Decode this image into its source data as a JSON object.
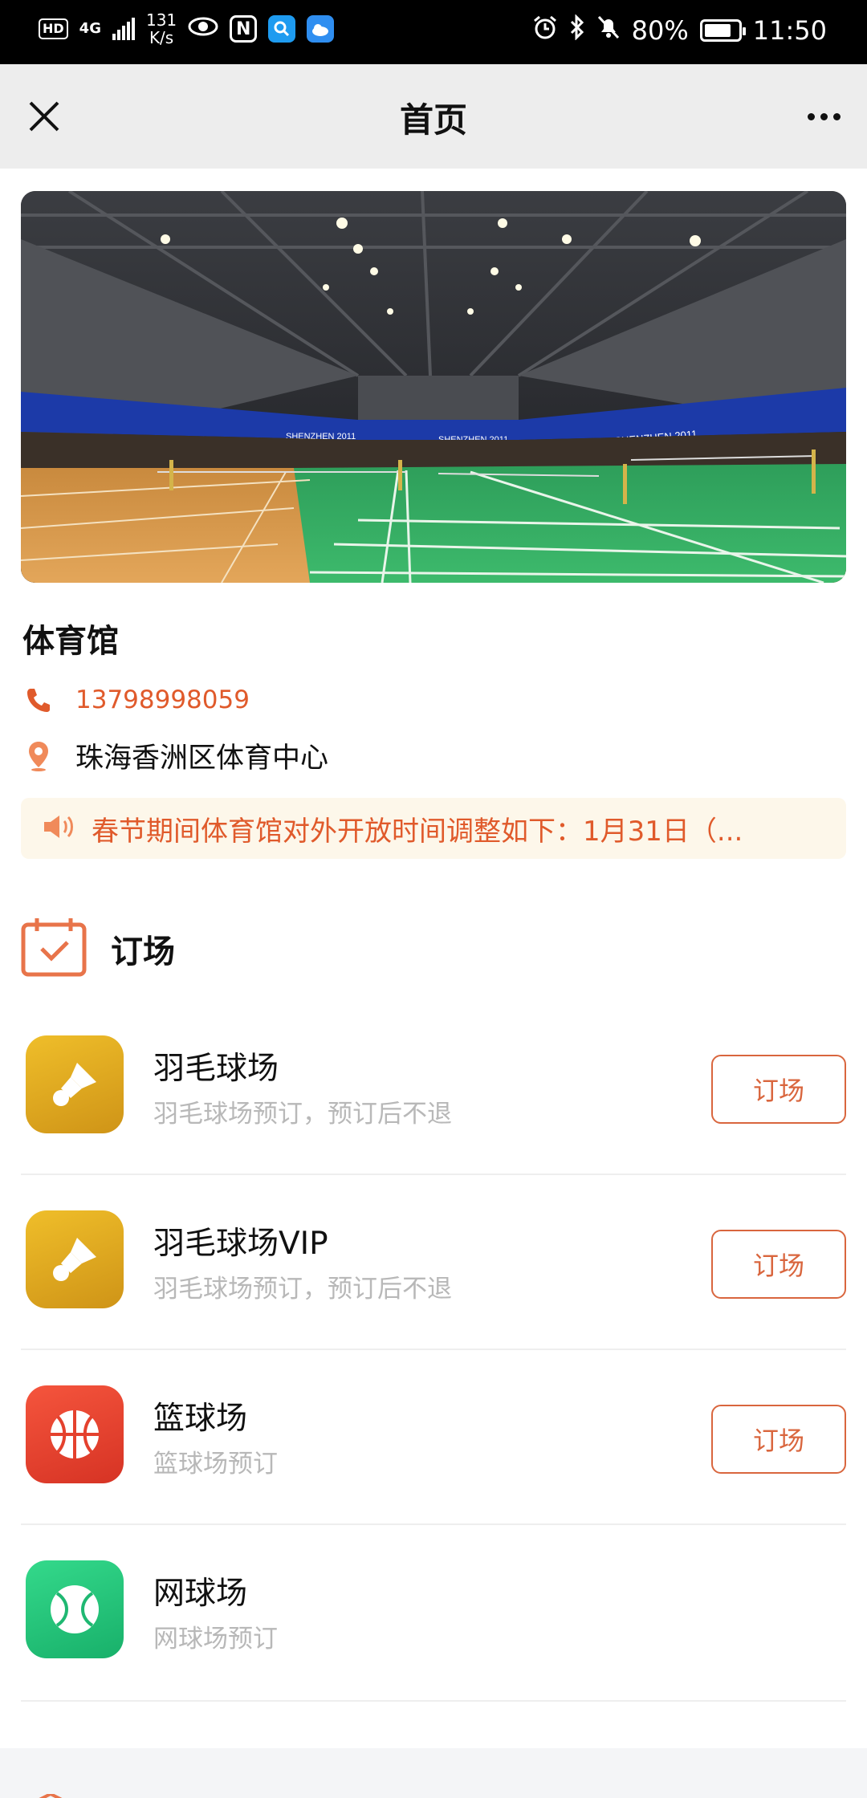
{
  "status_bar": {
    "hd": "HD",
    "network": "4G",
    "speed_value": "131",
    "speed_unit": "K/s",
    "battery": "80%",
    "time": "11:50"
  },
  "nav": {
    "title": "首页"
  },
  "venue": {
    "name": "体育馆",
    "phone": "13798998059",
    "address": "珠海香洲区体育中心",
    "notice": "春节期间体育馆对外开放时间调整如下：1月31日（..."
  },
  "hero_banners": [
    "SHENZHEN 2011",
    "SHENZHEN 2011",
    "SHENZHEN 2011"
  ],
  "booking": {
    "section_title": "订场",
    "courts": [
      {
        "name": "羽毛球场",
        "description": "羽毛球场预订，预订后不退",
        "button": "订场",
        "icon": "shuttlecock-icon",
        "color": "#d9a21c"
      },
      {
        "name": "羽毛球场VIP",
        "description": "羽毛球场预订，预订后不退",
        "button": "订场",
        "icon": "shuttlecock-icon",
        "color": "#d9a21c"
      },
      {
        "name": "篮球场",
        "description": "篮球场预订",
        "button": "订场",
        "icon": "basketball-icon",
        "color": "#e8432e"
      },
      {
        "name": "网球场",
        "description": "网球场预订",
        "icon": "tennis-ball-icon",
        "color": "#23c27a"
      }
    ]
  },
  "colors": {
    "accent": "#e05a2b",
    "button_border": "#d9663e",
    "notice_bg": "#fdf7ea",
    "nav_bg": "#ededed"
  }
}
